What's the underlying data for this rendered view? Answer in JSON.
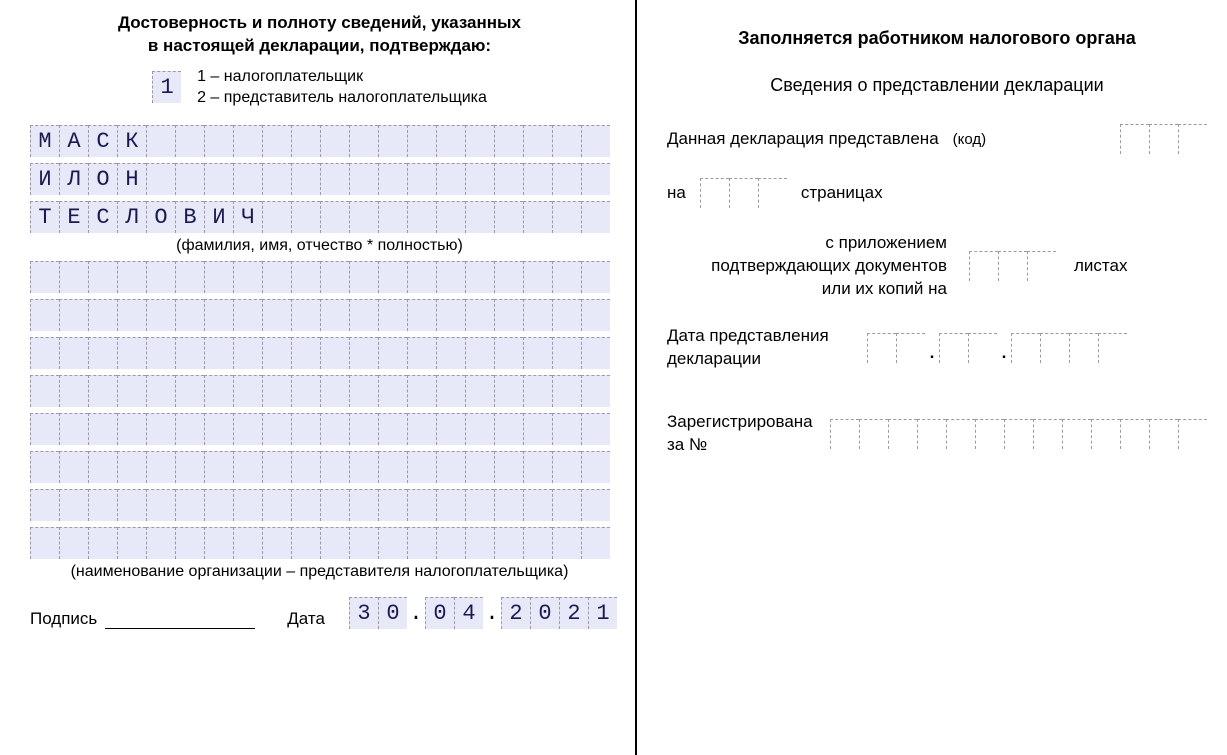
{
  "left": {
    "heading_l1": "Достоверность и полноту сведений, указанных",
    "heading_l2": "в настоящей декларации, подтверждаю:",
    "declarant_type": "1",
    "legend_1": "1 – налогоплательщик",
    "legend_2": "2 – представитель налогоплательщика",
    "last_name": "МАСК",
    "first_name": "ИЛОН",
    "patronymic": "ТЕСЛОВИЧ",
    "name_caption": "(фамилия, имя, отчество * полностью)",
    "org_caption": "(наименование организации – представителя налогоплательщика)",
    "signature_label": "Подпись",
    "date_label": "Дата",
    "date_day": "30",
    "date_month": "04",
    "date_year": "2021"
  },
  "right": {
    "title": "Заполняется работником налогового органа",
    "subtitle": "Сведения о представлении декларации",
    "row1_label": "Данная декларация представлена",
    "row1_code": "(код)",
    "row2_prefix": "на",
    "row2_suffix": "страницах",
    "row3_l1": "с приложением",
    "row3_l2": "подтверждающих документов",
    "row3_l3": "или их копий на",
    "row3_suffix": "листах",
    "row4_l1": "Дата представления",
    "row4_l2": "декларации",
    "row5_l1": "Зарегистрирована",
    "row5_l2": "за  №"
  }
}
